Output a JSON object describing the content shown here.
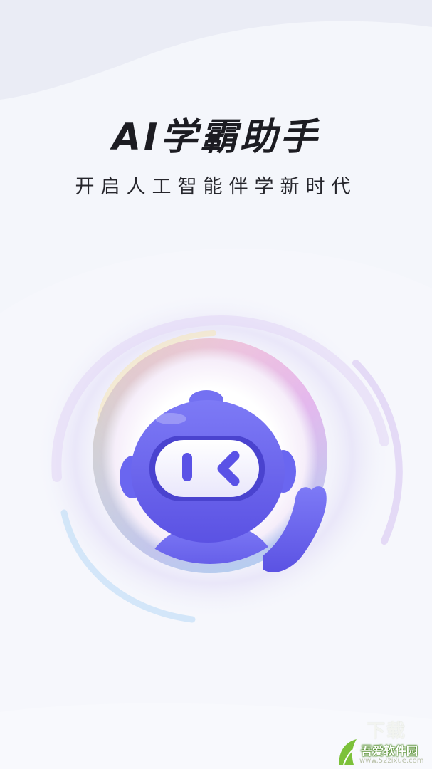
{
  "splash": {
    "title": "AI学霸助手",
    "subtitle": "开启人工智能伴学新时代"
  },
  "mascot": {
    "icon": "robot-mascot-icon"
  },
  "watermark": {
    "faded_text": "下载",
    "site_name": "吾爱软件园",
    "url": "www.52zixue.com"
  },
  "colors": {
    "background": "#f4f6fb",
    "title": "#1c1c22",
    "robot_body": "#6a66f0",
    "robot_dark": "#4d45d6",
    "visor_face": "#5a52e6"
  }
}
